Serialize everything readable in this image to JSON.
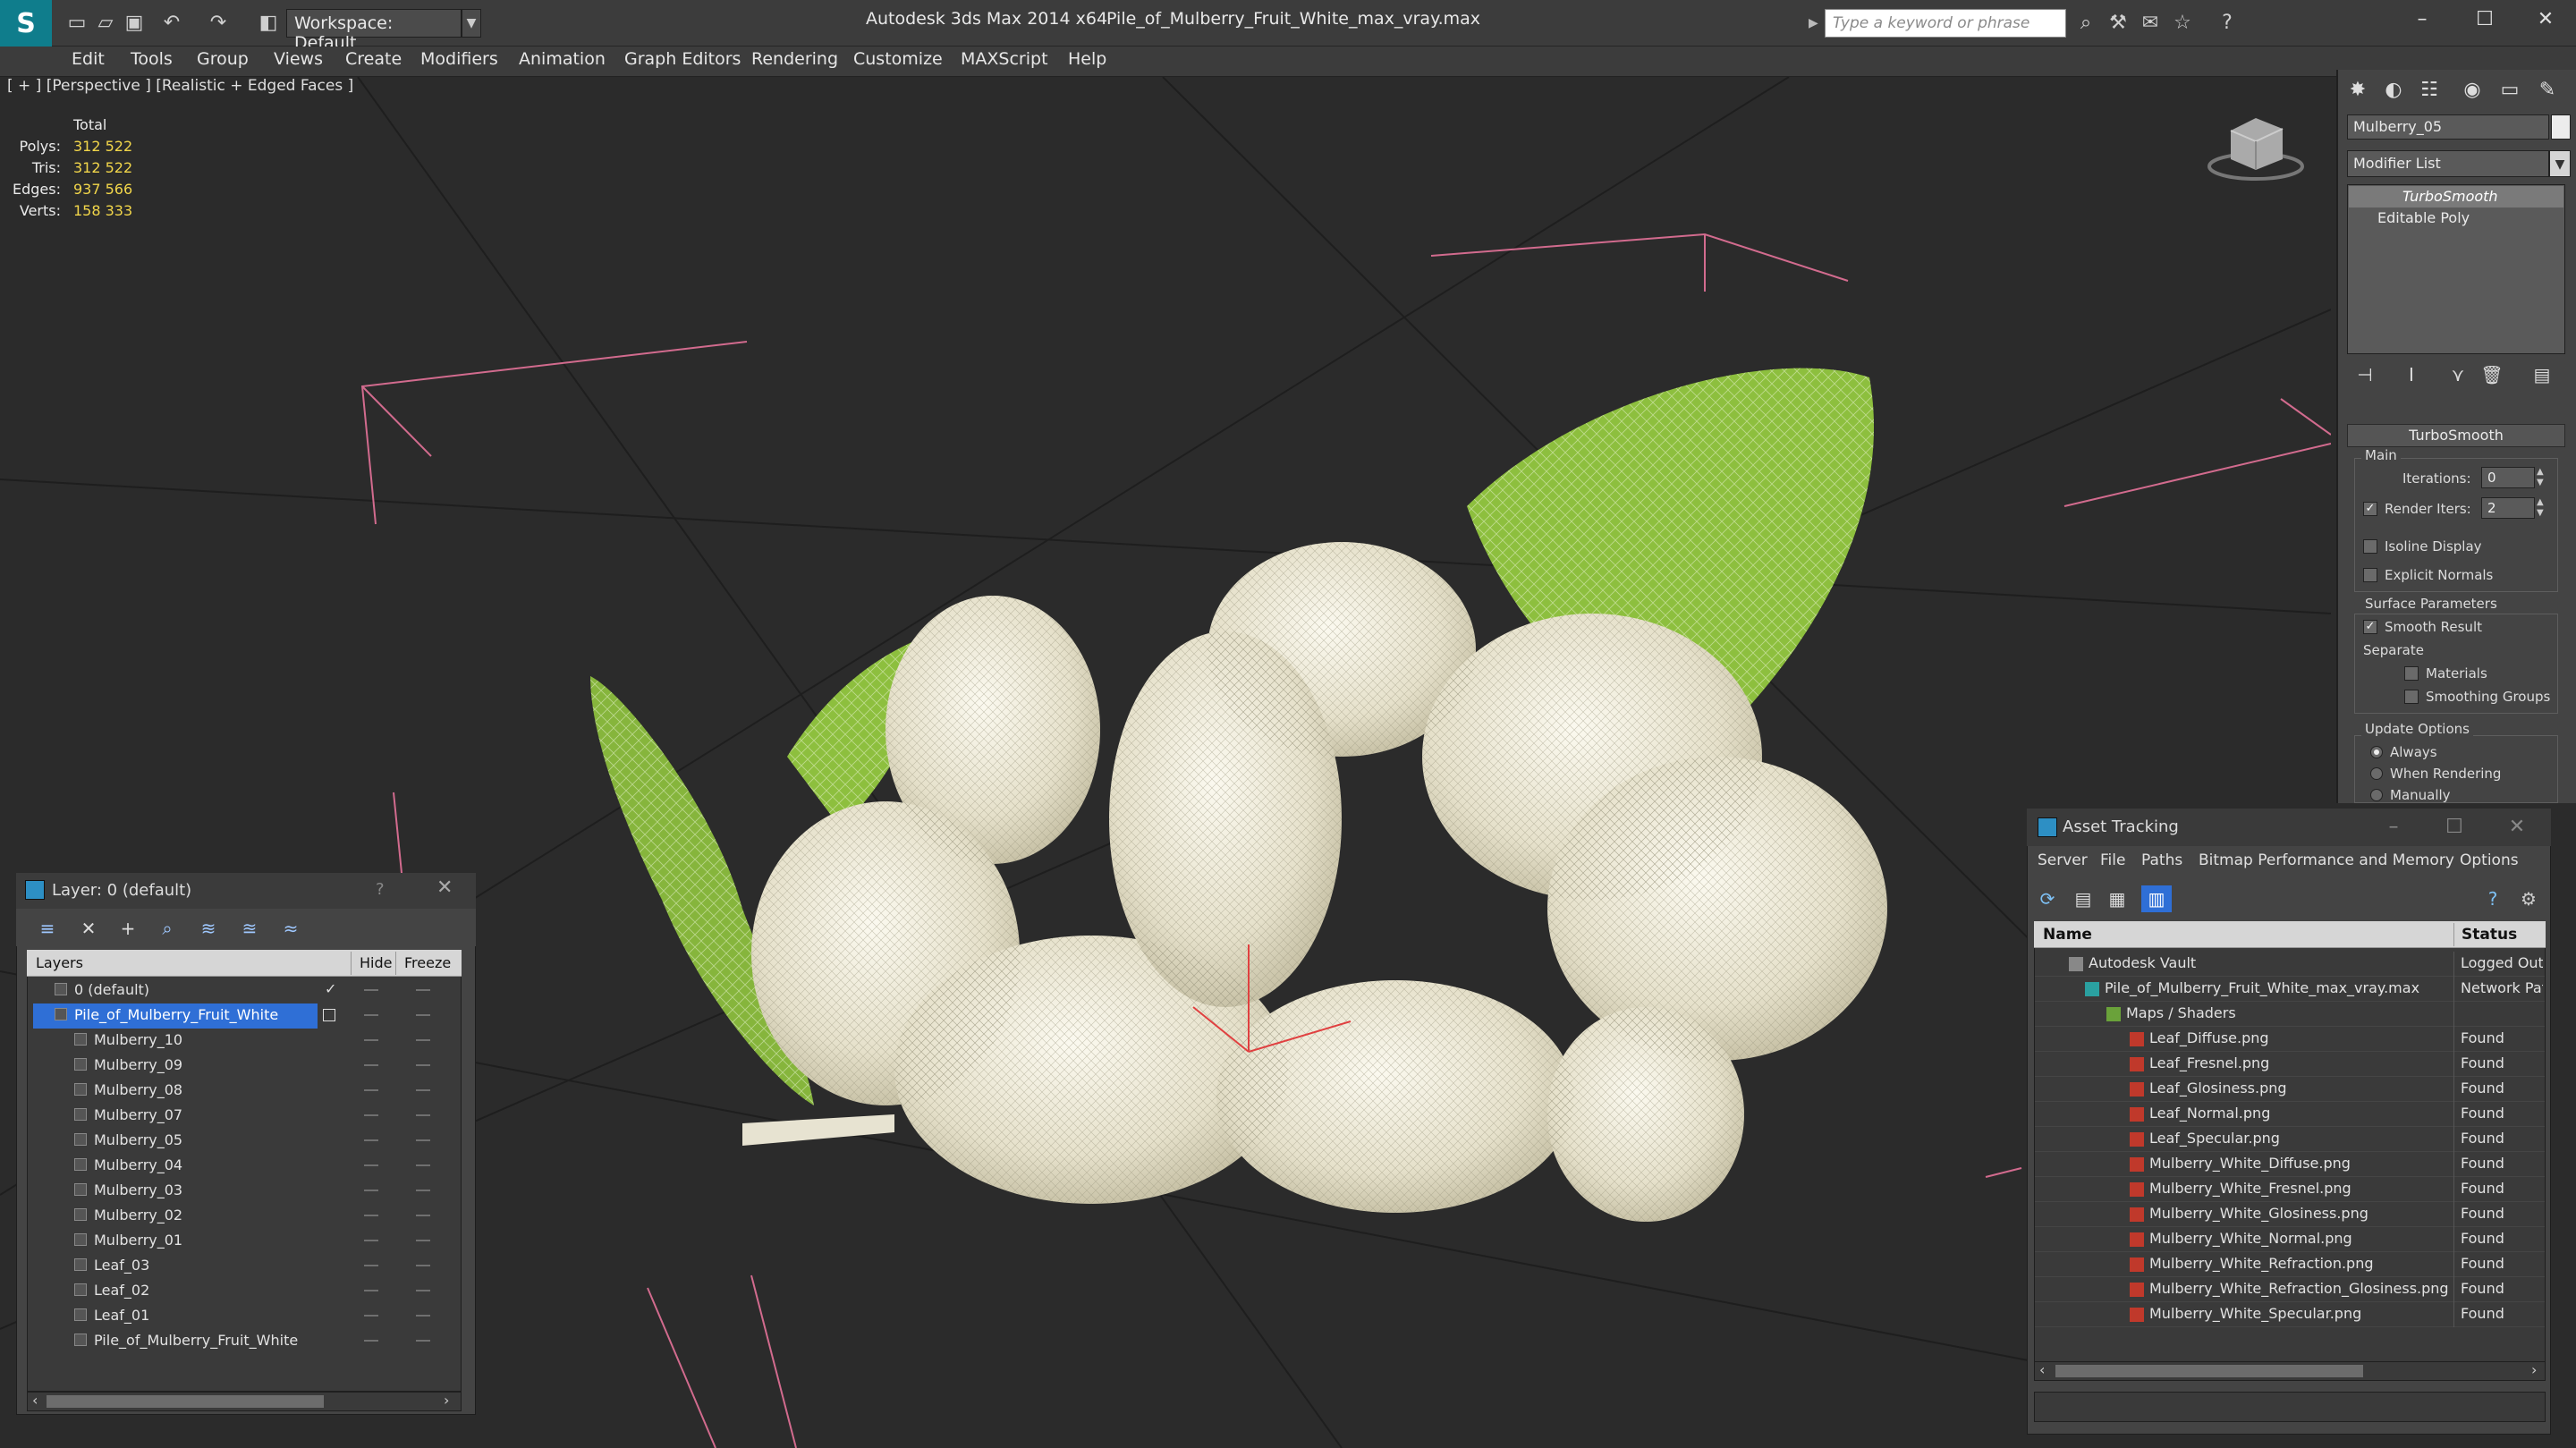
{
  "titlebar": {
    "workspace": "Workspace: Default",
    "app_title": "Autodesk 3ds Max  2014 x64",
    "file_title": "Pile_of_Mulberry_Fruit_White_max_vray.max",
    "search_placeholder": "Type a keyword or phrase"
  },
  "menu": [
    "Edit",
    "Tools",
    "Group",
    "Views",
    "Create",
    "Modifiers",
    "Animation",
    "Graph Editors",
    "Rendering",
    "Customize",
    "MAXScript",
    "Help"
  ],
  "viewport": {
    "label": "[ + ] [Perspective ] [Realistic + Edged Faces ]",
    "stats": {
      "total_label": "Total",
      "rows": [
        {
          "label": "Polys:",
          "value": "312 522"
        },
        {
          "label": "Tris:",
          "value": "312 522"
        },
        {
          "label": "Edges:",
          "value": "937 566"
        },
        {
          "label": "Verts:",
          "value": "158 333"
        }
      ]
    }
  },
  "command_panel": {
    "object_name": "Mulberry_05",
    "modifier_list": "Modifier List",
    "stack": [
      "TurboSmooth",
      "Editable Poly"
    ],
    "rollout": "TurboSmooth",
    "main_label": "Main",
    "iterations_label": "Iterations:",
    "iterations_value": "0",
    "render_iters_label": "Render Iters:",
    "render_iters_value": "2",
    "isoline_label": "Isoline Display",
    "explicit_normals_label": "Explicit Normals",
    "surface_params_label": "Surface Parameters",
    "smooth_result_label": "Smooth Result",
    "separate_label": "Separate",
    "materials_label": "Materials",
    "smoothing_groups_label": "Smoothing Groups",
    "update_options_label": "Update Options",
    "always_label": "Always",
    "when_rendering_label": "When Rendering",
    "manually_label": "Manually"
  },
  "layer_window": {
    "title": "Layer: 0 (default)",
    "help": "?",
    "col_layers": "Layers",
    "col_hide": "Hide",
    "col_freeze": "Freeze",
    "rows": [
      "0 (default)",
      "Pile_of_Mulberry_Fruit_White",
      "Mulberry_10",
      "Mulberry_09",
      "Mulberry_08",
      "Mulberry_07",
      "Mulberry_05",
      "Mulberry_04",
      "Mulberry_03",
      "Mulberry_02",
      "Mulberry_01",
      "Leaf_03",
      "Leaf_02",
      "Leaf_01",
      "Pile_of_Mulberry_Fruit_White"
    ]
  },
  "asset_window": {
    "title": "Asset Tracking",
    "menu": [
      "Server",
      "File",
      "Paths",
      "Bitmap Performance and Memory",
      "Options"
    ],
    "col_name": "Name",
    "col_status": "Status",
    "rows": [
      {
        "name": "Autodesk Vault",
        "status": "Logged Out"
      },
      {
        "name": "Pile_of_Mulberry_Fruit_White_max_vray.max",
        "status": "Network Path"
      },
      {
        "name": "Maps / Shaders",
        "status": ""
      },
      {
        "name": "Leaf_Diffuse.png",
        "status": "Found"
      },
      {
        "name": "Leaf_Fresnel.png",
        "status": "Found"
      },
      {
        "name": "Leaf_Glosiness.png",
        "status": "Found"
      },
      {
        "name": "Leaf_Normal.png",
        "status": "Found"
      },
      {
        "name": "Leaf_Specular.png",
        "status": "Found"
      },
      {
        "name": "Mulberry_White_Diffuse.png",
        "status": "Found"
      },
      {
        "name": "Mulberry_White_Fresnel.png",
        "status": "Found"
      },
      {
        "name": "Mulberry_White_Glosiness.png",
        "status": "Found"
      },
      {
        "name": "Mulberry_White_Normal.png",
        "status": "Found"
      },
      {
        "name": "Mulberry_White_Refraction.png",
        "status": "Found"
      },
      {
        "name": "Mulberry_White_Refraction_Glosiness.png",
        "status": "Found"
      },
      {
        "name": "Mulberry_White_Specular.png",
        "status": "Found"
      }
    ]
  },
  "colors": {
    "accent": "#0f7d8c",
    "selection": "#2f6fd6",
    "stat_yellow": "#f2d64a",
    "leaf_green": "#8dbf3e",
    "berry_white": "#ece8d6"
  }
}
